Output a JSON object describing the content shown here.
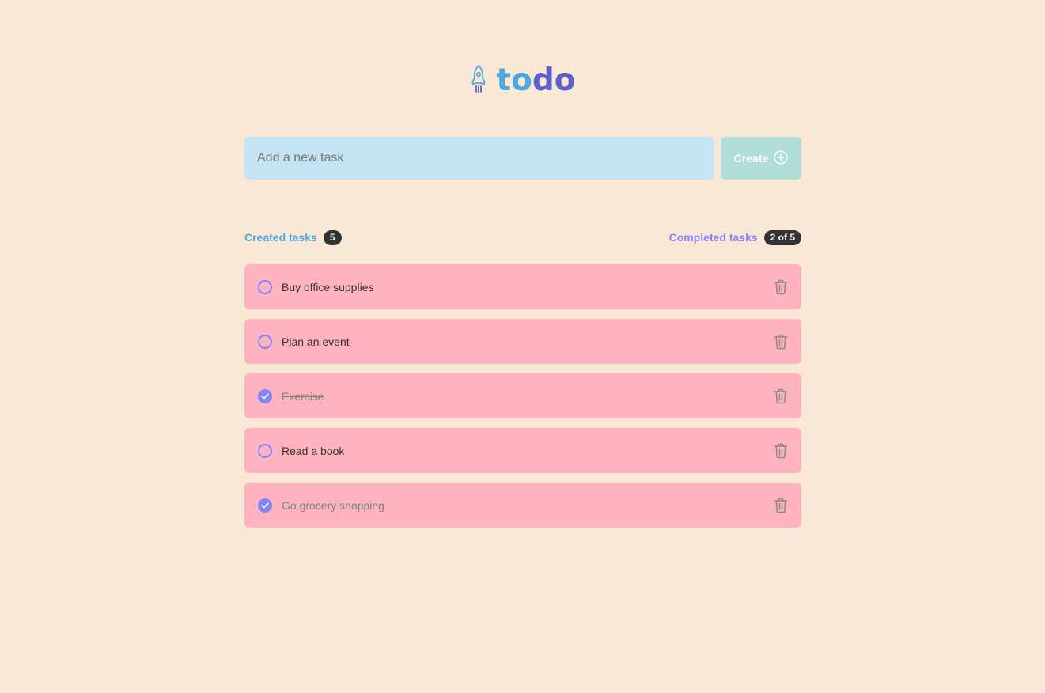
{
  "logo": {
    "icon": "rocket-icon",
    "text_part1": "to",
    "text_part2": "do",
    "color_part1": "#4ea8de",
    "color_part2": "#5e60ce"
  },
  "new_task": {
    "placeholder": "Add a new task",
    "value": "",
    "create_label": "Create",
    "create_icon": "plus-circle-icon"
  },
  "stats": {
    "created_label": "Created tasks",
    "created_count": "5",
    "completed_label": "Completed tasks",
    "completed_count": "2 of 5"
  },
  "tasks": [
    {
      "text": "Buy office supplies",
      "completed": false
    },
    {
      "text": "Plan an event",
      "completed": false
    },
    {
      "text": "Exercise",
      "completed": true
    },
    {
      "text": "Read a book",
      "completed": false
    },
    {
      "text": "Go grocery shopping",
      "completed": true
    }
  ],
  "colors": {
    "background": "#f9e8d5",
    "input_background": "#c4e3f3",
    "create_button": "#b1ddd9",
    "task_background": "#ffb3c0",
    "checkbox": "#8284fa",
    "badge": "#333333"
  }
}
